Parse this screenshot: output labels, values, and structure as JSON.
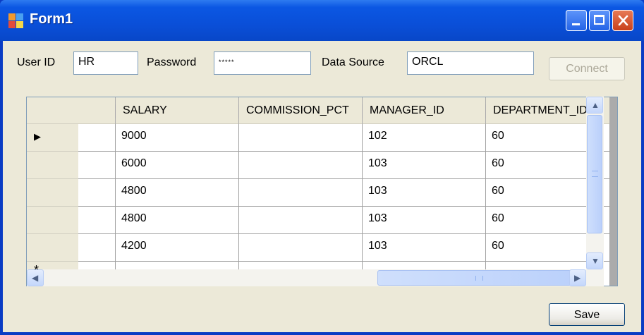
{
  "window": {
    "title": "Form1",
    "controls": [
      "minimize-icon",
      "maximize-icon",
      "close-icon"
    ]
  },
  "form": {
    "userid_label": "User ID",
    "userid_value": "HR",
    "password_label": "Password",
    "password_value": "*****",
    "datasource_label": "Data Source",
    "datasource_value": "ORCL",
    "connect_label": "Connect",
    "save_label": "Save"
  },
  "grid": {
    "columns": [
      "",
      "SALARY",
      "COMMISSION_PCT",
      "MANAGER_ID",
      "DEPARTMENT_ID"
    ],
    "rows": [
      [
        "",
        "9000",
        "",
        "102",
        "60"
      ],
      [
        "",
        "6000",
        "",
        "103",
        "60"
      ],
      [
        "",
        "4800",
        "",
        "103",
        "60"
      ],
      [
        "",
        "4800",
        "",
        "103",
        "60"
      ],
      [
        "",
        "4200",
        "",
        "103",
        "60"
      ]
    ],
    "current_row_indicator": "▶",
    "new_row_indicator": "*"
  },
  "colors": {
    "titlebar": "#0b57e3",
    "client": "#ece9d8",
    "textbox_border": "#7f9db9",
    "scrollbar": "#c4d7fb"
  }
}
